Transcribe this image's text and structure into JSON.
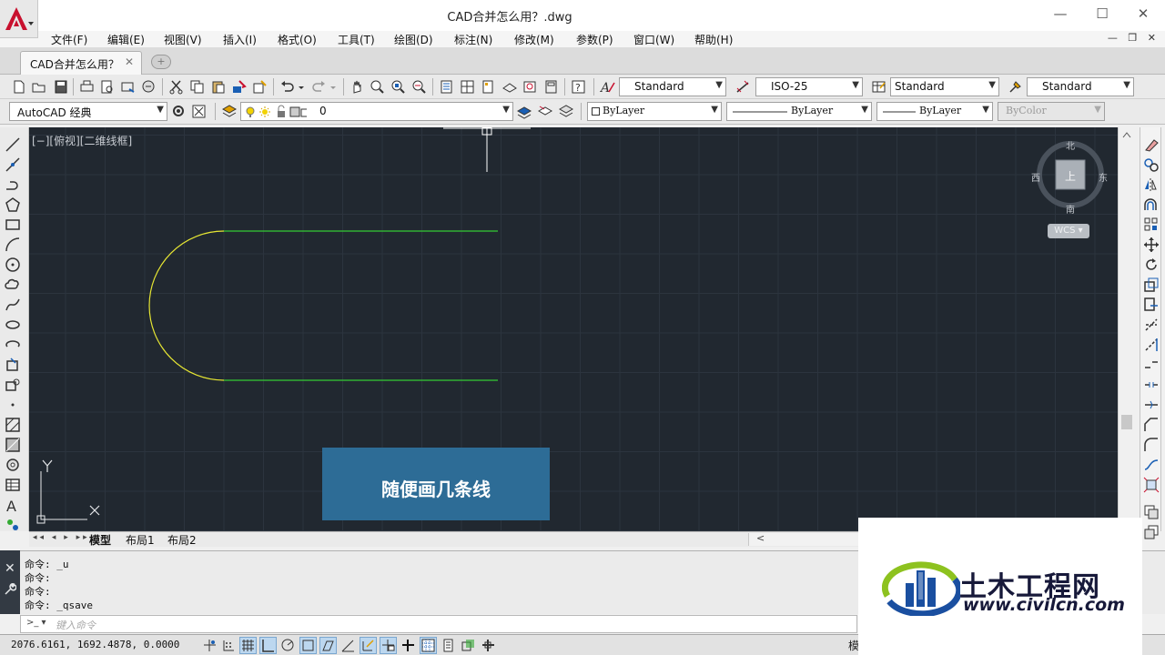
{
  "window": {
    "title": "CAD合并怎么用？.dwg",
    "minimize": "—",
    "maximize": "☐",
    "close": "✕"
  },
  "menu": [
    "文件(F)",
    "编辑(E)",
    "视图(V)",
    "插入(I)",
    "格式(O)",
    "工具(T)",
    "绘图(D)",
    "标注(N)",
    "修改(M)",
    "参数(P)",
    "窗口(W)",
    "帮助(H)"
  ],
  "mdi_controls": "— ❐ ✕",
  "tabs": {
    "document": "CAD合并怎么用？",
    "close": "✕",
    "new": "+"
  },
  "styles": {
    "text_style": "Standard",
    "dim_style": "ISO-25",
    "table_style": "Standard",
    "multileader_style": "Standard"
  },
  "workspace": "AutoCAD 经典",
  "layer": "0",
  "properties": {
    "color": "ByLayer",
    "linetype": "ByLayer",
    "lineweight": "ByLayer",
    "plotstyle": "ByColor"
  },
  "viewport_label": "[−][俯视][二维线框]",
  "viewcube": {
    "north": "北",
    "south": "南",
    "east": "东",
    "west": "西",
    "face": "上",
    "wcs": "WCS"
  },
  "ucs": {
    "x": "X",
    "y": "Y"
  },
  "banner": "随便画几条线",
  "layout_nav": "◂◂ ◂ ▸ ▸▸",
  "layout_tabs": [
    "模型",
    "布局1",
    "布局2"
  ],
  "hscroll_arrow": "<",
  "command_history": [
    "命令: _u",
    "命令:",
    "命令:",
    "命令: _qsave"
  ],
  "command_prompt": ">_ ▾",
  "command_placeholder": "键入命令",
  "coordinates": "2076.6161,  1692.4878,  0.0000",
  "status_right": "模",
  "watermark": {
    "name": "土木工程网",
    "url": "www.civilcn.com"
  },
  "colors": {
    "canvas": "#212830",
    "arc": "#e6e633",
    "line": "#33cc33",
    "banner": "#2d6c96"
  }
}
